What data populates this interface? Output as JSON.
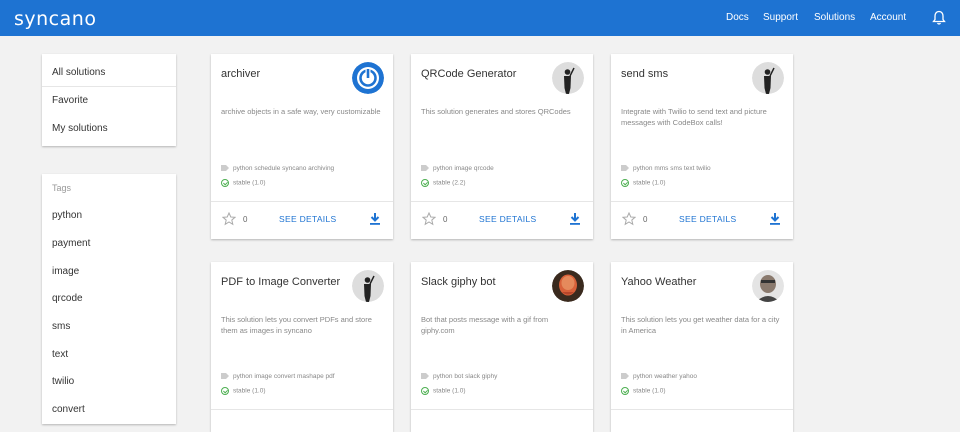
{
  "header": {
    "logo": "syncano",
    "nav": [
      "Docs",
      "Support",
      "Solutions",
      "Account"
    ],
    "bg_color": "#1e73d2"
  },
  "sidebar": {
    "filters": [
      "All solutions",
      "Favorite",
      "My solutions"
    ],
    "tags_title": "Tags",
    "tags": [
      "python",
      "payment",
      "image",
      "qrcode",
      "sms",
      "text",
      "twilio",
      "convert"
    ]
  },
  "cards": [
    {
      "title": "archiver",
      "description": "archive objects in a safe way, very customizable",
      "tags": "python schedule syncano archiving",
      "stable": "stable (1.0)",
      "stars": "0",
      "details": "SEE DETAILS",
      "avatar": "power-logo"
    },
    {
      "title": "QRCode Generator",
      "description": "This solution generates and stores QRCodes",
      "tags": "python image qrcode",
      "stable": "stable (2.2)",
      "stars": "0",
      "details": "SEE DETAILS",
      "avatar": "silhouette"
    },
    {
      "title": "send sms",
      "description": "Integrate with Twilio to send text and picture messages with CodeBox calls!",
      "tags": "python mms sms text twilio",
      "stable": "stable (1.0)",
      "stars": "0",
      "details": "SEE DETAILS",
      "avatar": "silhouette"
    },
    {
      "title": "PDF to Image Converter",
      "description": "This solution lets you convert PDFs and store them as images in syncano",
      "tags": "python image convert mashape pdf",
      "stable": "stable (1.0)",
      "stars": "",
      "details": "",
      "avatar": "silhouette"
    },
    {
      "title": "Slack giphy bot",
      "description": "Bot that posts message with a gif from giphy.com",
      "tags": "python bot slack giphy",
      "stable": "stable (1.0)",
      "stars": "",
      "details": "",
      "avatar": "face-red"
    },
    {
      "title": "Yahoo Weather",
      "description": "This solution lets you get weather data for a city in America",
      "tags": "python weather yahoo",
      "stable": "stable (1.0)",
      "stars": "",
      "details": "",
      "avatar": "face-gray"
    }
  ]
}
